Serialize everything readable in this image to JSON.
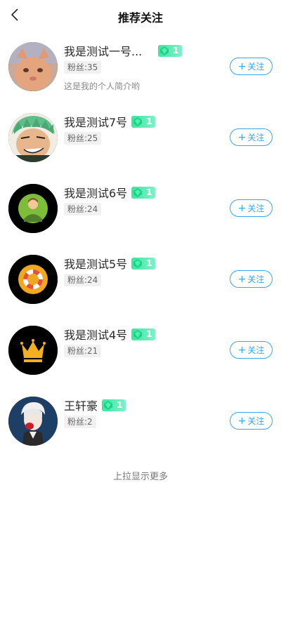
{
  "header": {
    "title": "推荐关注",
    "back_icon": "chevron-left-icon"
  },
  "users": [
    {
      "name": "我是测试一号...",
      "level": "1",
      "fans": "粉丝:35",
      "intro": "这是我的个人简介哟",
      "follow_label": "关注"
    },
    {
      "name": "我是测试7号",
      "level": "1",
      "fans": "粉丝:25",
      "follow_label": "关注"
    },
    {
      "name": "我是测试6号",
      "level": "1",
      "fans": "粉丝:24",
      "follow_label": "关注"
    },
    {
      "name": "我是测试5号",
      "level": "1",
      "fans": "粉丝:24",
      "follow_label": "关注"
    },
    {
      "name": "我是测试4号",
      "level": "1",
      "fans": "粉丝:21",
      "follow_label": "关注"
    },
    {
      "name": "王轩豪",
      "level": "1",
      "fans": "粉丝:2",
      "follow_label": "关注"
    }
  ],
  "footer": {
    "load_more": "上拉显示更多"
  },
  "colors": {
    "accent": "#3aa7e8",
    "badge_start": "#3be6a2",
    "badge_end": "#7ff0c9"
  }
}
